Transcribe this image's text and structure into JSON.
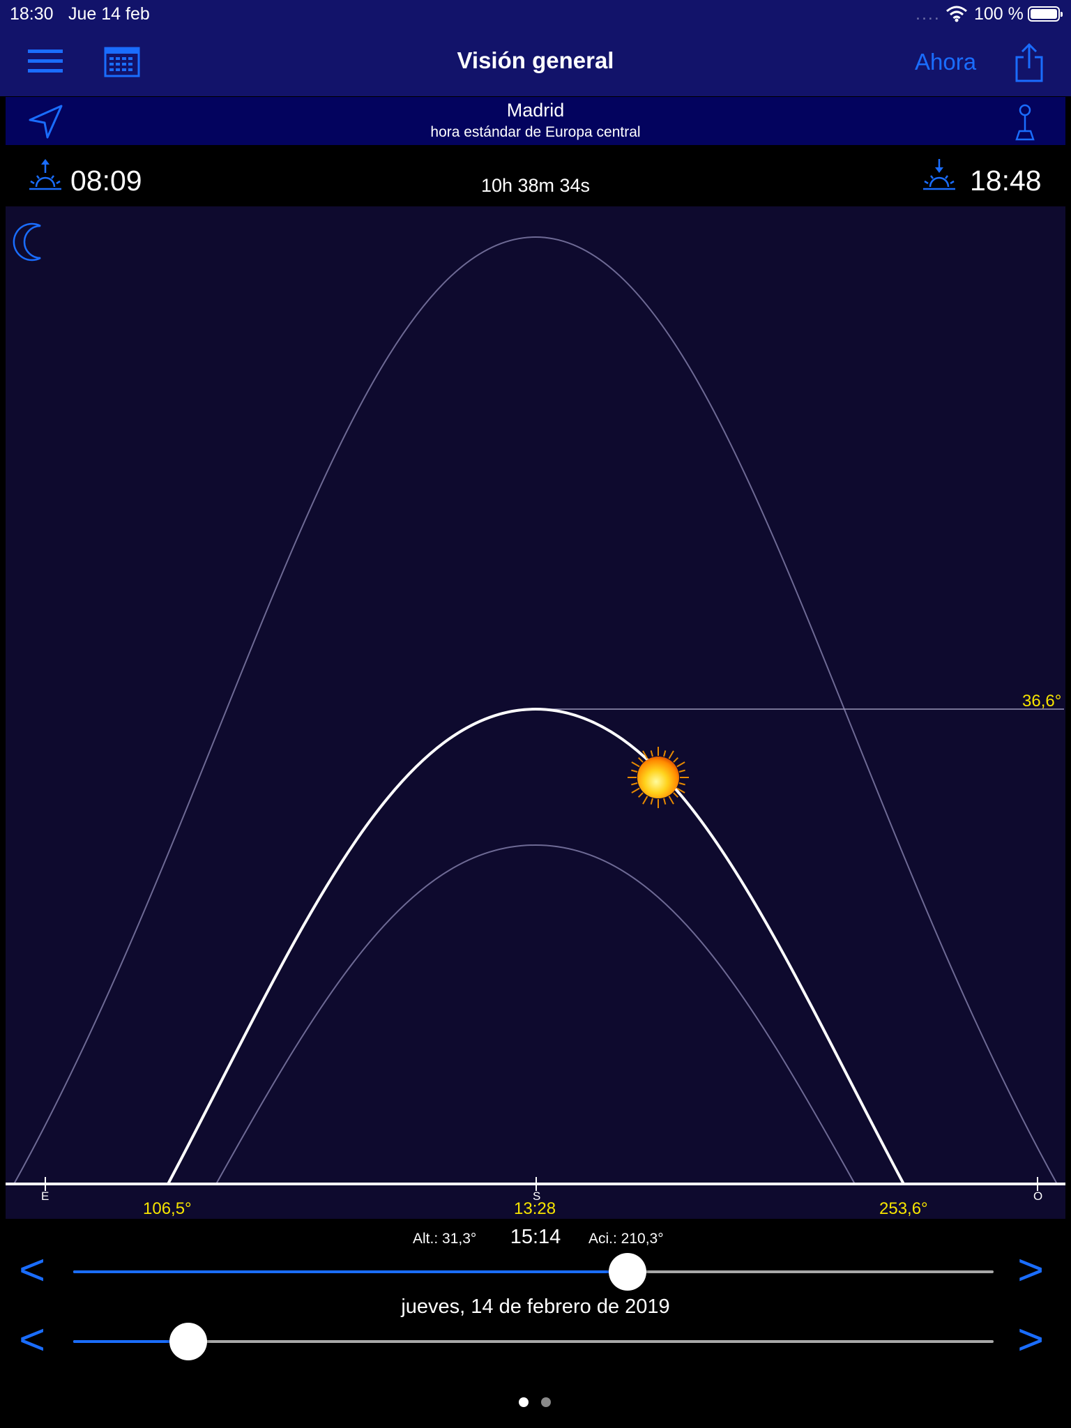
{
  "status": {
    "time": "18:30",
    "date": "Jue 14 feb",
    "signal": "....",
    "battery": "100 %"
  },
  "nav": {
    "title": "Visión general",
    "now_label": "Ahora",
    "icons": [
      "menu-icon",
      "calendar-icon",
      "share-icon"
    ]
  },
  "location": {
    "city": "Madrid",
    "timezone": "hora estándar de Europa central",
    "icons": [
      "location-arrow-icon",
      "pin-icon"
    ]
  },
  "sun": {
    "sunrise": "08:09",
    "sunset": "18:48",
    "day_length": "10h 38m 34s"
  },
  "chart_data": {
    "type": "line",
    "title": "",
    "x_axis_ticks": [
      "E",
      "S",
      "O"
    ],
    "annotations": {
      "max_altitude": "36,6°",
      "sunrise_azimuth": "106,5°",
      "solar_noon": "13:28",
      "sunset_azimuth": "253,6°"
    },
    "series": [
      {
        "role": "current-day",
        "rise_azimuth": 106.5,
        "noon_azimuth": 180,
        "set_azimuth": 253.6,
        "max_altitude": 36.6
      },
      {
        "role": "summer-solstice-reference",
        "max_altitude": 74.5
      },
      {
        "role": "winter-solstice-reference",
        "max_altitude": 27.7
      }
    ],
    "sun_position": {
      "altitude": 31.3,
      "azimuth": 210.3
    }
  },
  "position": {
    "altitude": "Alt.: 31,3°",
    "time": "15:14",
    "azimuth": "Aci.: 210,3°"
  },
  "date_label": "jueves, 14 de febrero de 2019",
  "sliders": {
    "time_fraction": 0.602,
    "date_fraction": 0.125
  },
  "colors": {
    "accent": "#1a6dff",
    "nav_bg": "#12136a",
    "location_bg": "#03035e",
    "chart_bg": "#0e0a2e",
    "annotation": "#f7e400"
  },
  "pages": {
    "count": 2,
    "current": 1
  }
}
